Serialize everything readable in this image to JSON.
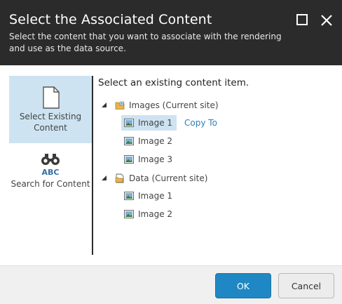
{
  "dialog": {
    "title": "Select the Associated Content",
    "subtitle": "Select the content that you want to associate with the rendering and use as the data source.",
    "maximize_icon": "maximize-icon",
    "close_icon": "close-icon"
  },
  "sidebar": {
    "items": [
      {
        "label": "Select Existing Content",
        "icon": "document-icon",
        "active": true
      },
      {
        "label": "Search for Content",
        "icon": "binoculars-abc-icon",
        "active": false
      }
    ]
  },
  "main": {
    "heading": "Select an existing content item.",
    "tree": [
      {
        "label": "Images (Current site)",
        "icon": "folder-images-icon",
        "expanded": true,
        "children": [
          {
            "label": "Image 1",
            "icon": "image-icon",
            "selected": true,
            "action": "Copy To"
          },
          {
            "label": "Image 2",
            "icon": "image-icon",
            "selected": false
          },
          {
            "label": "Image 3",
            "icon": "image-icon",
            "selected": false
          }
        ]
      },
      {
        "label": "Data (Current site)",
        "icon": "data-folder-icon",
        "expanded": true,
        "children": [
          {
            "label": "Image 1",
            "icon": "image-icon",
            "selected": false
          },
          {
            "label": "Image 2",
            "icon": "image-icon",
            "selected": false
          }
        ]
      }
    ]
  },
  "footer": {
    "ok_label": "OK",
    "cancel_label": "Cancel"
  },
  "colors": {
    "header_bg": "#2b2b2b",
    "selection_bg": "#cde3f1",
    "primary_button": "#1f88c4",
    "link": "#2b7fb8"
  }
}
